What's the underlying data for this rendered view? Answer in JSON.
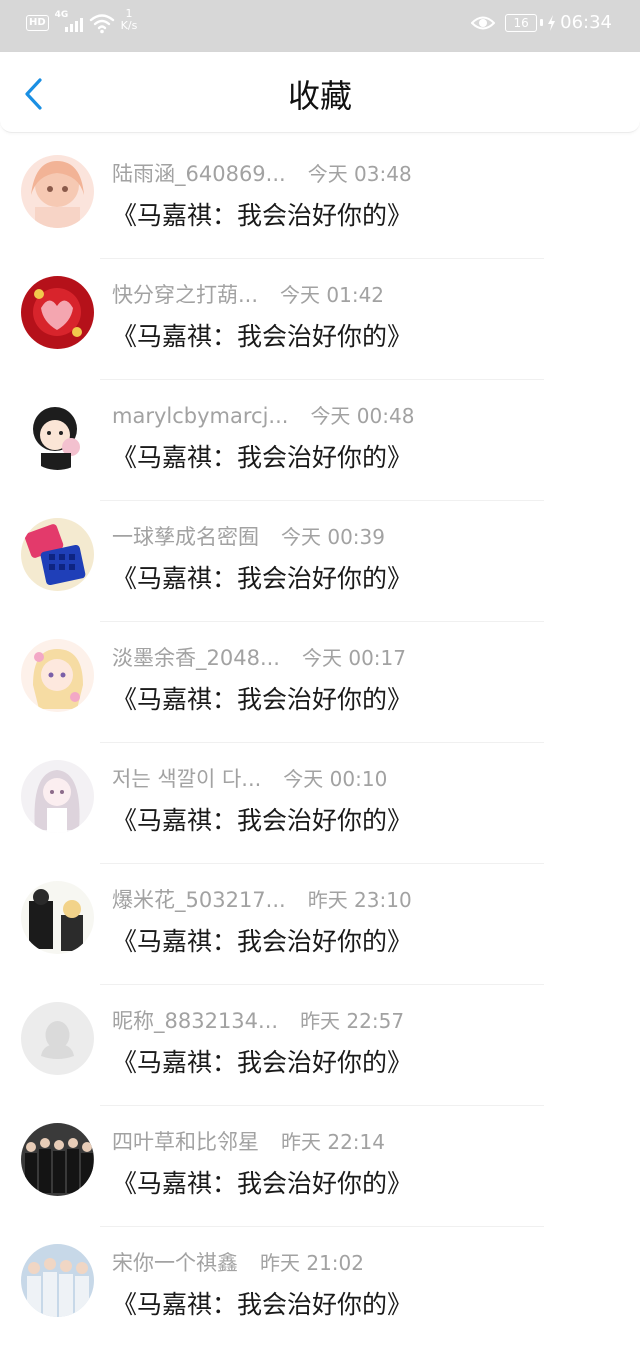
{
  "status_bar": {
    "hd": "HD",
    "signal_tag": "4G",
    "speed_value": "1",
    "speed_unit": "K/s",
    "battery": "16",
    "time": "06:34"
  },
  "header": {
    "title": "收藏",
    "accent": "#1a8fe3"
  },
  "items": [
    {
      "nickname": "陆雨涵_640869...",
      "time": "今天 03:48",
      "title": "《马嘉祺：我会治好你的》"
    },
    {
      "nickname": "快分穿之打葫...",
      "time": "今天 01:42",
      "title": "《马嘉祺：我会治好你的》"
    },
    {
      "nickname": "marylcbymarcj...",
      "time": "今天 00:48",
      "title": "《马嘉祺：我会治好你的》"
    },
    {
      "nickname": "一球孳成名密囿",
      "time": "今天 00:39",
      "title": "《马嘉祺：我会治好你的》"
    },
    {
      "nickname": "淡墨余香_2048...",
      "time": "今天 00:17",
      "title": "《马嘉祺：我会治好你的》"
    },
    {
      "nickname": "저는 색깔이 다...",
      "time": "今天 00:10",
      "title": "《马嘉祺：我会治好你的》"
    },
    {
      "nickname": "爆米花_503217...",
      "time": "昨天 23:10",
      "title": "《马嘉祺：我会治好你的》"
    },
    {
      "nickname": "昵称_8832134...",
      "time": "昨天 22:57",
      "title": "《马嘉祺：我会治好你的》"
    },
    {
      "nickname": "四叶草和比邻星",
      "time": "昨天 22:14",
      "title": "《马嘉祺：我会治好你的》"
    },
    {
      "nickname": "宋你一个祺鑫",
      "time": "昨天 21:02",
      "title": "《马嘉祺：我会治好你的》"
    }
  ],
  "icons": {
    "back": "chevron-left-icon",
    "status": [
      "signal-icon",
      "wifi-icon",
      "eye-icon",
      "battery-icon",
      "charging-bolt-icon"
    ]
  }
}
